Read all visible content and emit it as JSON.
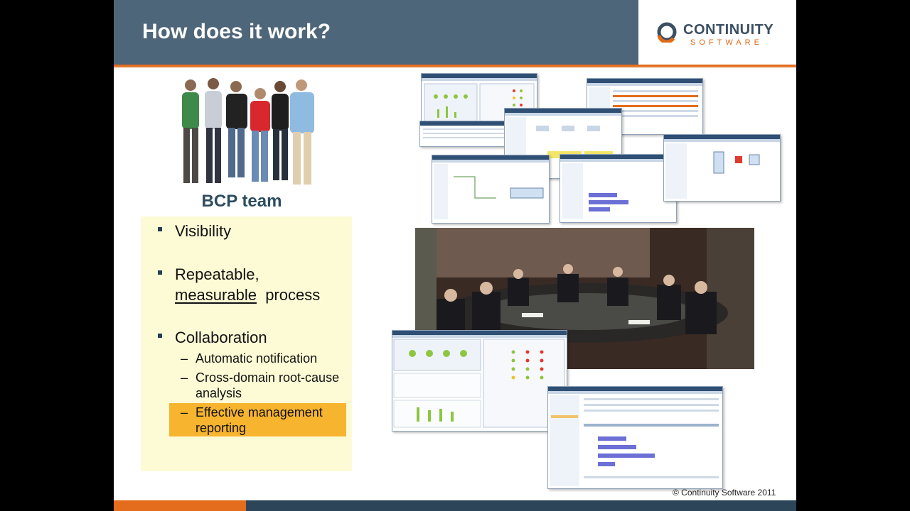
{
  "title": "How does it work?",
  "logo": {
    "top": "CONTINUITY",
    "bottom": "SOFTWARE"
  },
  "team_label": "BCP team",
  "bullets": {
    "visibility": "Visibility",
    "repeatable": "Repeatable,",
    "measurable": "measurable",
    "process": "process",
    "collaboration": "Collaboration",
    "sub1": "Automatic notification",
    "sub2a": "Cross-domain root-cause",
    "sub2b": "analysis",
    "sub3a": "Effective management",
    "sub3b": "reporting"
  },
  "copyright": "© Continuity Software 2011",
  "colors": {
    "header": "#4e6679",
    "accent": "#e36c1d",
    "box": "#fdfbd5",
    "highlight": "#f7b42e"
  }
}
